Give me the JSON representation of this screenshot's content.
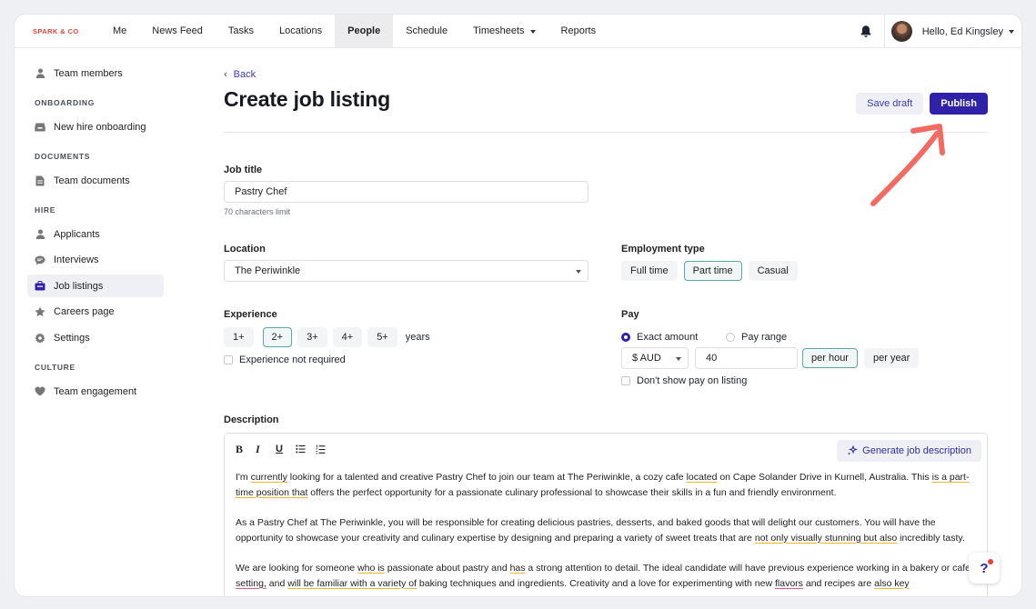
{
  "brand": "SPARK & CO",
  "nav": [
    "Me",
    "News Feed",
    "Tasks",
    "Locations",
    "People",
    "Schedule",
    "Timesheets",
    "Reports"
  ],
  "user": {
    "greeting": "Hello, Ed Kingsley"
  },
  "sidebar": {
    "top": "Team members",
    "onboarding_head": "ONBOARDING",
    "onboarding": "New hire onboarding",
    "documents_head": "DOCUMENTS",
    "documents": "Team documents",
    "hire_head": "HIRE",
    "hire": [
      "Applicants",
      "Interviews",
      "Job listings",
      "Careers page",
      "Settings"
    ],
    "culture_head": "CULTURE",
    "culture": "Team engagement"
  },
  "page": {
    "back": "Back",
    "title": "Create job listing",
    "save_draft": "Save draft",
    "publish": "Publish"
  },
  "form": {
    "job_title_label": "Job title",
    "job_title_value": "Pastry Chef",
    "job_title_hint": "70 characters limit",
    "location_label": "Location",
    "location_value": "The Periwinkle",
    "employment_label": "Employment type",
    "employment_options": [
      "Full time",
      "Part time",
      "Casual"
    ],
    "experience_label": "Experience",
    "experience_options": [
      "1+",
      "2+",
      "3+",
      "4+",
      "5+"
    ],
    "experience_unit": "years",
    "experience_not_required": "Experience not required",
    "pay_label": "Pay",
    "pay_exact": "Exact amount",
    "pay_range": "Pay range",
    "currency": "$ AUD",
    "amount": "40",
    "per_hour": "per hour",
    "per_year": "per year",
    "hide_pay": "Don't show pay on listing",
    "description_label": "Description",
    "generate": "Generate job description"
  },
  "description": {
    "p1_a": "I'm ",
    "p1_u1": "currently",
    "p1_b": " looking for a talented and creative Pastry Chef to join our team at The Periwinkle, a cozy cafe ",
    "p1_u2": "located",
    "p1_c": " on Cape Solander Drive in Kurnell, Australia. This ",
    "p1_u3": "is a part-time position that",
    "p1_d": " offers the perfect opportunity for a passionate culinary professional to showcase their skills in a fun and friendly environment.",
    "p2_a": "As a Pastry Chef at The Periwinkle, you will be responsible for creating delicious pastries, desserts, and baked goods that will delight our customers. You will have the opportunity to showcase your creativity and culinary expertise by designing and preparing a variety of sweet treats that are ",
    "p2_u1": "not only visually stunning but also",
    "p2_b": " incredibly tasty.",
    "p3_a": "We are looking for someone ",
    "p3_u1": "who is",
    "p3_b": " passionate about pastry and ",
    "p3_u2": "has",
    "p3_c": " a strong attention to detail. The ideal candidate will have previous experience working in a bakery or cafe ",
    "p3_u3": "setting,",
    "p3_d": " and ",
    "p3_u4": "will be familiar with a variety of",
    "p3_e": " baking techniques and ingredients. Creativity and a love for experimenting with new ",
    "p3_u5": "flavors",
    "p3_f": " and recipes are ",
    "p3_u6": "also key"
  },
  "colors": {
    "accent": "#2f22a8",
    "brand": "#e0453a",
    "selected_border": "#5da5a6",
    "arrow": "#f26b63"
  }
}
